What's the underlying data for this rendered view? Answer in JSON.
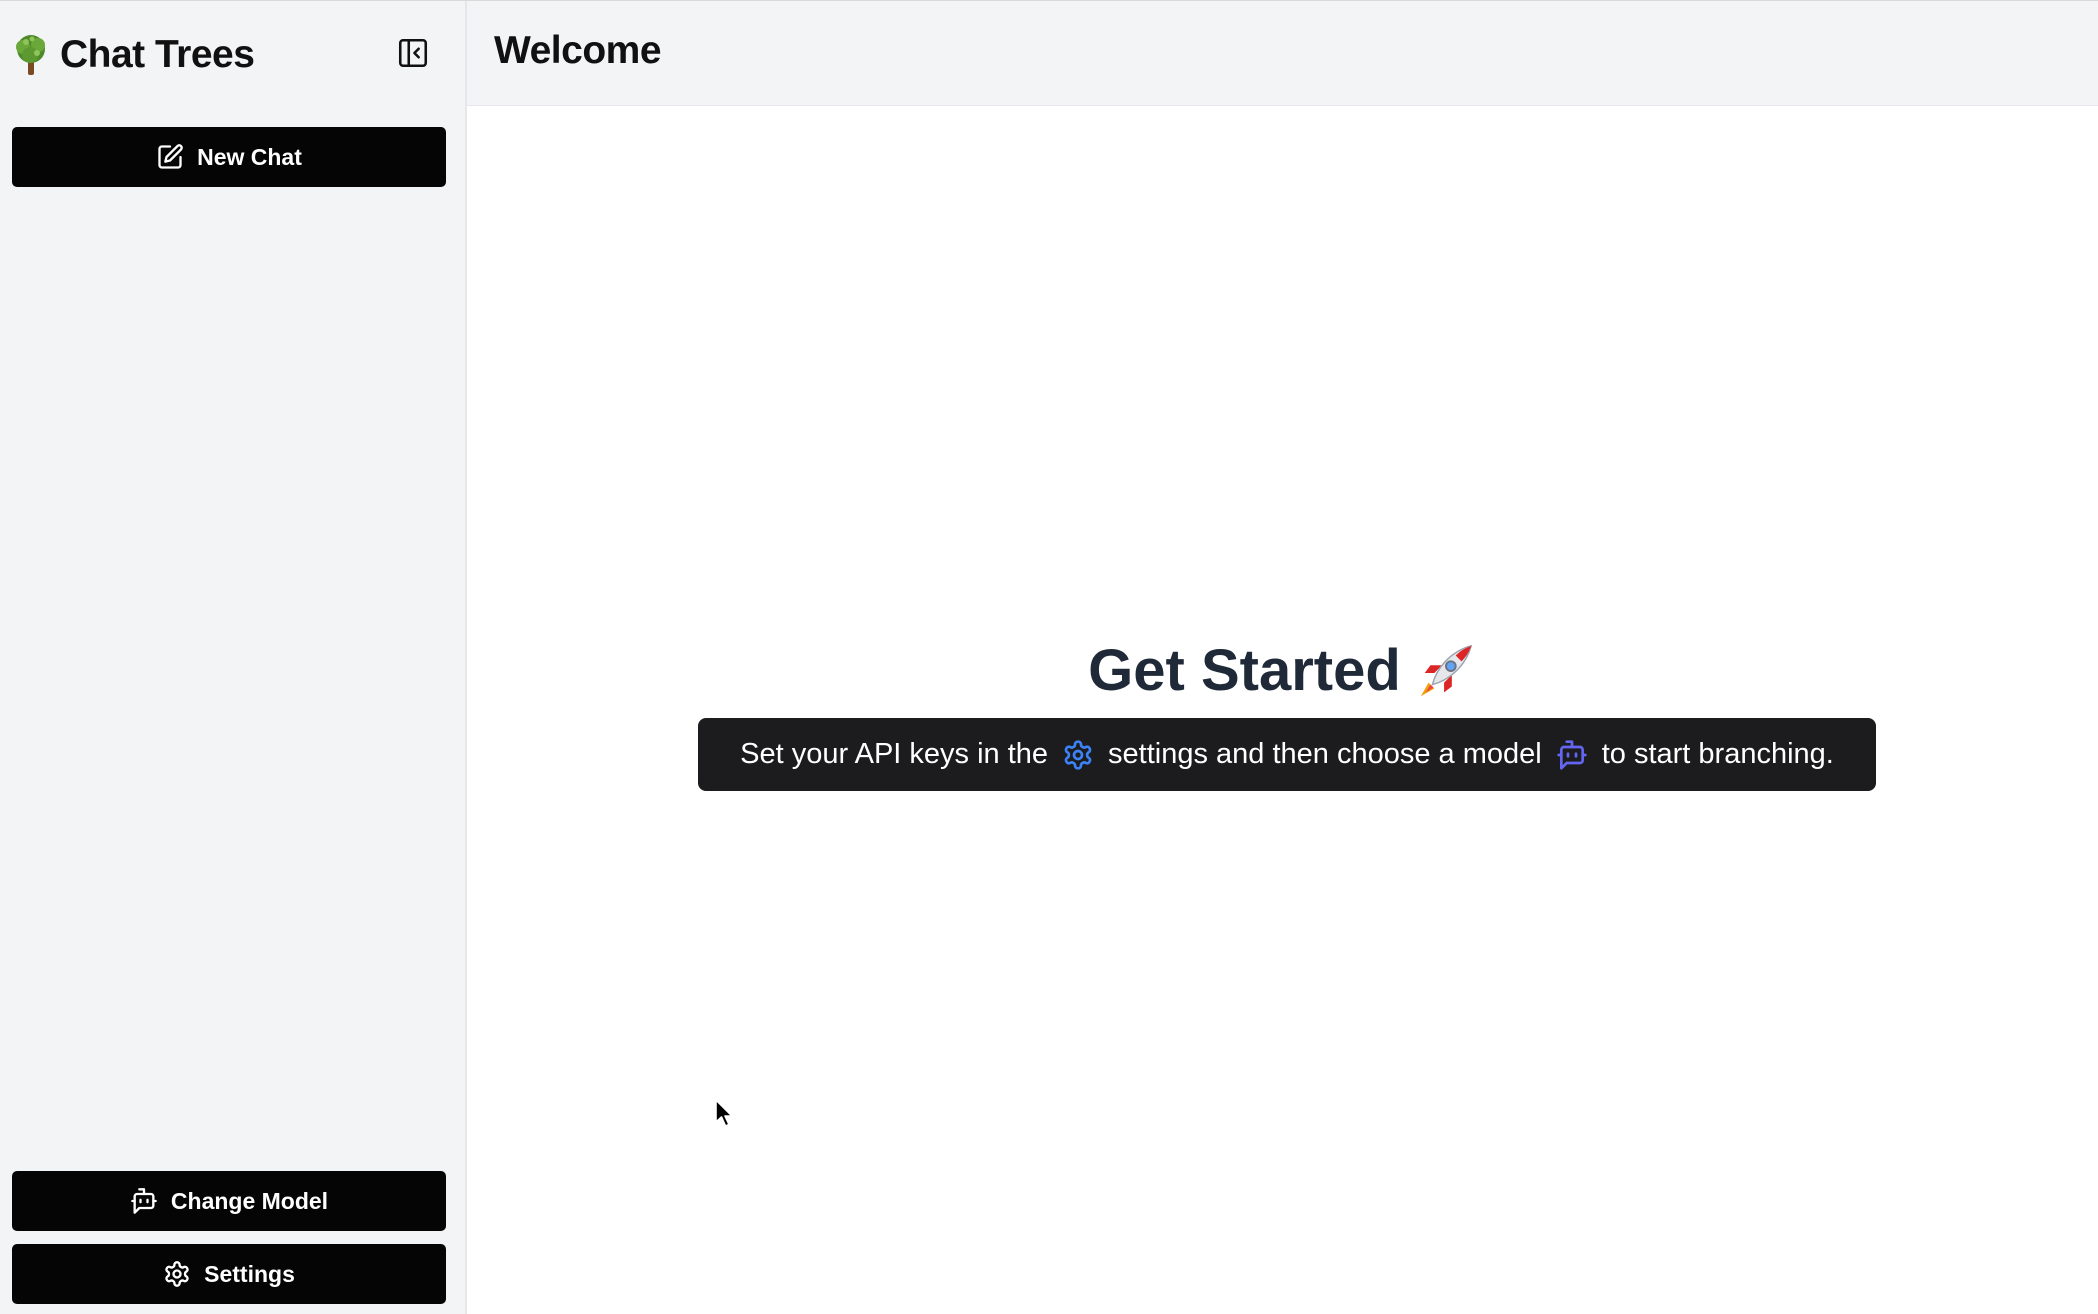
{
  "sidebar": {
    "brand_title": "Chat Trees",
    "brand_icon": "tree-icon",
    "collapse_icon": "sidebar-collapse-icon",
    "new_chat_label": "New Chat",
    "new_chat_icon": "pencil-square-icon",
    "change_model_label": "Change Model",
    "change_model_icon": "bot-icon",
    "settings_label": "Settings",
    "settings_icon": "gear-icon"
  },
  "main": {
    "title": "Welcome",
    "hero": {
      "title": "Get Started",
      "emoji_icon": "rocket-icon"
    },
    "hint": {
      "part1": "Set your API keys in the",
      "part2": "settings and then choose a model",
      "part3": "to start branching.",
      "settings_icon": "gear-icon",
      "model_icon": "bot-icon"
    }
  },
  "colors": {
    "sidebar_bg": "#f3f4f6",
    "button_bg": "#050505",
    "hint_bg": "#1c1c1e",
    "gear_accent": "#3b82f6",
    "bot_accent": "#6366f1",
    "hero_text": "#1f2937"
  }
}
